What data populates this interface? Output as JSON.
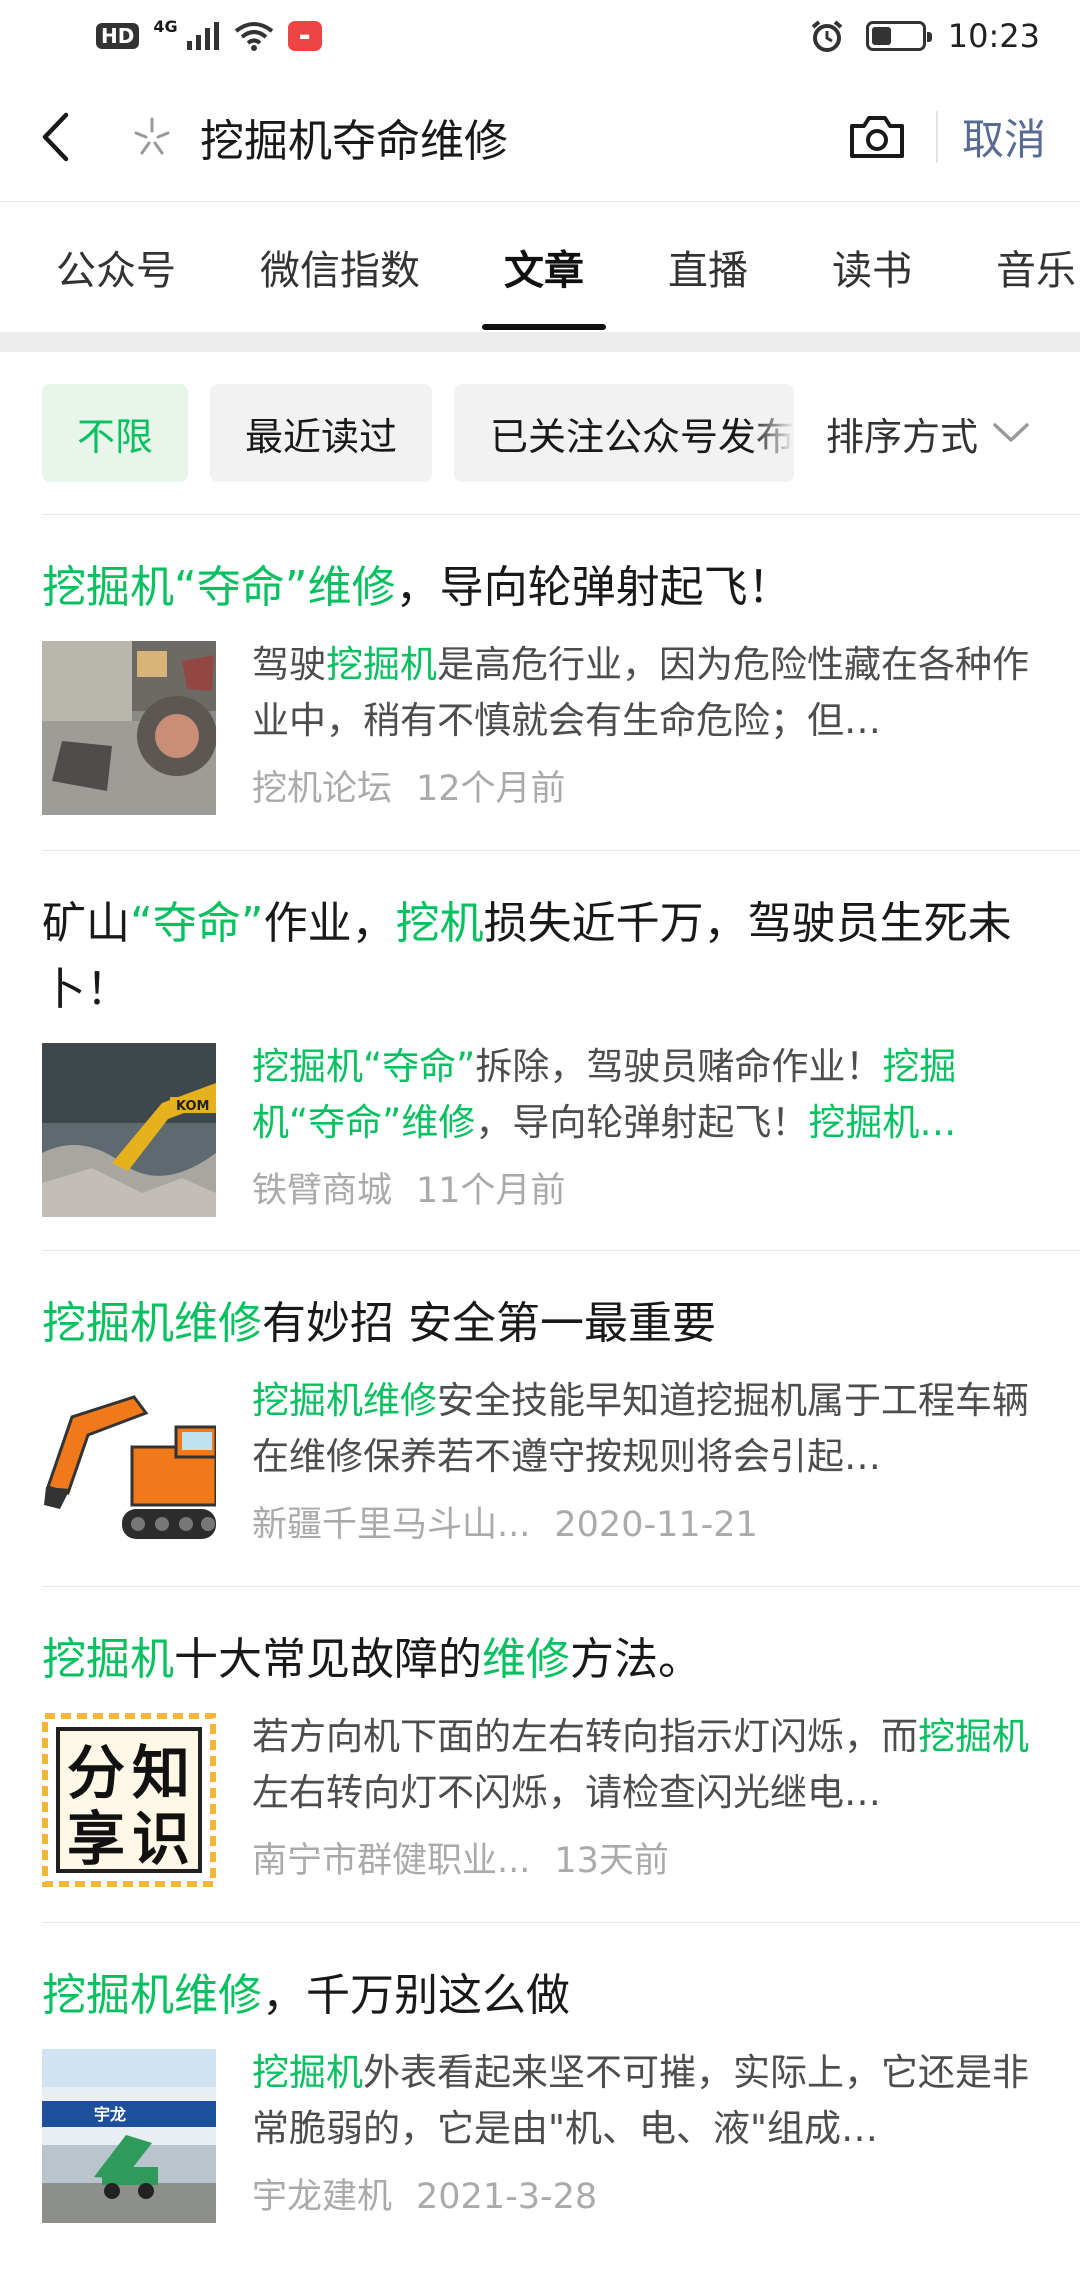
{
  "status_bar": {
    "hd": "HD",
    "network": "4G",
    "time": "10:23",
    "battery_level": 0.4
  },
  "header": {
    "query": "挖掘机夺命维修",
    "cancel": "取消"
  },
  "tabs": [
    "公众号",
    "微信指数",
    "文章",
    "直播",
    "读书",
    "音乐"
  ],
  "active_tab": "文章",
  "filters": {
    "all": "不限",
    "recent": "最近读过",
    "followed": "已关注公众号发布",
    "sort": "排序方式"
  },
  "articles": [
    {
      "title": [
        {
          "t": "挖掘机",
          "h": true
        },
        {
          "t": "“夺命”",
          "h": true
        },
        {
          "t": "维修",
          "h": true
        },
        {
          "t": "，导向轮弹射起飞！",
          "h": false
        }
      ],
      "snippet": [
        {
          "t": "驾驶",
          "h": false
        },
        {
          "t": "挖掘机",
          "h": true
        },
        {
          "t": "是高危行业，因为危险性藏在各种作业中，稍有不慎就会有生命危险；但…",
          "h": false
        }
      ],
      "source": "挖机论坛",
      "time": "12个月前",
      "thumb": "machine-wreck-photo"
    },
    {
      "title": [
        {
          "t": "矿山",
          "h": false
        },
        {
          "t": "“夺命”",
          "h": true
        },
        {
          "t": "作业，",
          "h": false
        },
        {
          "t": "挖机",
          "h": true
        },
        {
          "t": "损失近千万，驾驶员生死未卜！",
          "h": false
        }
      ],
      "snippet": [
        {
          "t": "挖掘机",
          "h": true
        },
        {
          "t": "“夺命”",
          "h": true
        },
        {
          "t": "拆除，驾驶员赌命作业！",
          "h": false
        },
        {
          "t": "挖掘机",
          "h": true
        },
        {
          "t": "“夺命”",
          "h": true
        },
        {
          "t": "维修",
          "h": true
        },
        {
          "t": "，导向轮弹射起飞！",
          "h": false
        },
        {
          "t": "挖掘机…",
          "h": true
        }
      ],
      "source": "铁臂商城",
      "time": "11个月前",
      "thumb": "demolition-excavator-photo"
    },
    {
      "title": [
        {
          "t": "挖掘机",
          "h": true
        },
        {
          "t": "维修",
          "h": true
        },
        {
          "t": "有妙招 安全第一最重要",
          "h": false
        }
      ],
      "snippet": [
        {
          "t": "挖掘机",
          "h": true
        },
        {
          "t": "维修",
          "h": true
        },
        {
          "t": "安全技能早知道挖掘机属于工程车辆在维修保养若不遵守按规则将会引起…",
          "h": false
        }
      ],
      "source": "新疆千里马斗山...",
      "time": "2020-11-21",
      "thumb": "orange-excavator-illustration"
    },
    {
      "title": [
        {
          "t": "挖掘机",
          "h": true
        },
        {
          "t": "十大常见故障的",
          "h": false
        },
        {
          "t": "维修",
          "h": true
        },
        {
          "t": "方法。",
          "h": false
        }
      ],
      "snippet": [
        {
          "t": "若方向机下面的左右转向指示灯闪烁，而",
          "h": false
        },
        {
          "t": "挖掘机",
          "h": true
        },
        {
          "t": "左右转向灯不闪烁，请检查闪光继电…",
          "h": false
        }
      ],
      "source": "南宁市群健职业...",
      "time": "13天前",
      "thumb": "share-knowledge-badge",
      "thumb_text": [
        "分",
        "知",
        "享",
        "识"
      ]
    },
    {
      "title": [
        {
          "t": "挖掘机",
          "h": true
        },
        {
          "t": "维修",
          "h": true
        },
        {
          "t": "，千万别这么做",
          "h": false
        }
      ],
      "snippet": [
        {
          "t": "挖掘机",
          "h": true
        },
        {
          "t": "外表看起来坚不可摧，实际上，它还是非常脆弱的，它是由\"机、电、液\"组成…",
          "h": false
        }
      ],
      "source": "宇龙建机",
      "time": "2021-3-28",
      "thumb": "factory-excavator-photo",
      "thumb_text": [
        "宇龙"
      ]
    }
  ],
  "colors": {
    "highlight": "#07c160",
    "link": "#576b95",
    "meta": "#aaaaaa"
  }
}
